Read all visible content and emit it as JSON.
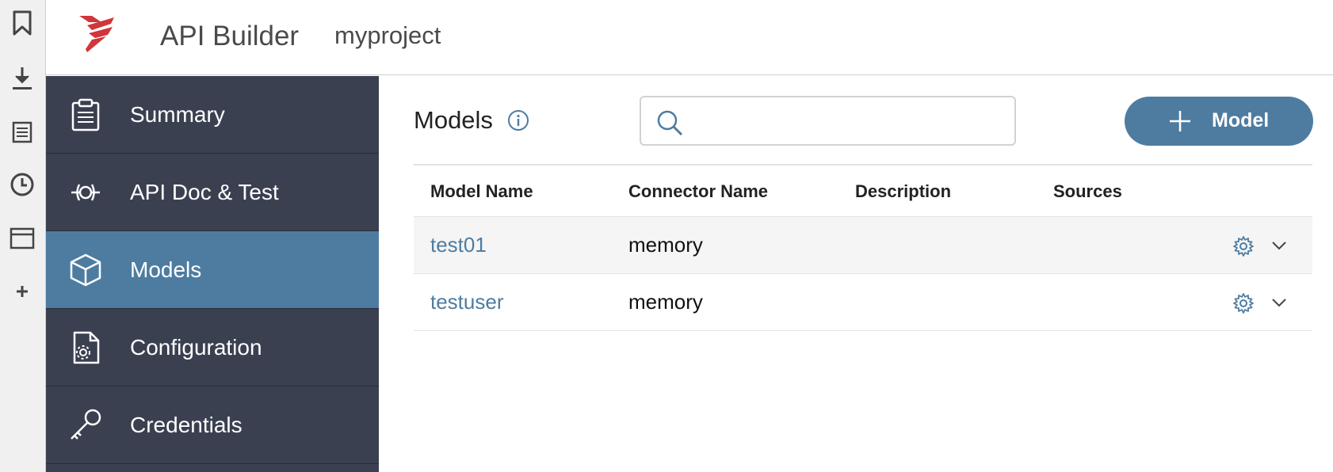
{
  "header": {
    "app_title": "API Builder",
    "project_name": "myproject",
    "logo_color": "#d0363a"
  },
  "side_toolbar": {
    "icons": [
      "bookmark-icon",
      "download-icon",
      "reading-list-icon",
      "history-icon",
      "window-icon",
      "plus-icon"
    ]
  },
  "nav": {
    "items": [
      {
        "label": "Summary",
        "icon": "clipboard-icon"
      },
      {
        "label": "API Doc & Test",
        "icon": "api-node-icon"
      },
      {
        "label": "Models",
        "icon": "cube-icon",
        "active": true
      },
      {
        "label": "Configuration",
        "icon": "config-file-icon"
      },
      {
        "label": "Credentials",
        "icon": "key-icon"
      }
    ],
    "bg_color": "#3b4051",
    "active_color": "#4e7ca1"
  },
  "main": {
    "title": "Models",
    "search": {
      "value": "",
      "placeholder": ""
    },
    "add_button_label": "Model",
    "table": {
      "columns": [
        "Model Name",
        "Connector Name",
        "Description",
        "Sources"
      ],
      "rows": [
        {
          "name": "test01",
          "connector": "memory",
          "description": "",
          "sources": ""
        },
        {
          "name": "testuser",
          "connector": "memory",
          "description": "",
          "sources": ""
        }
      ]
    },
    "link_color": "#4e7ca1"
  }
}
